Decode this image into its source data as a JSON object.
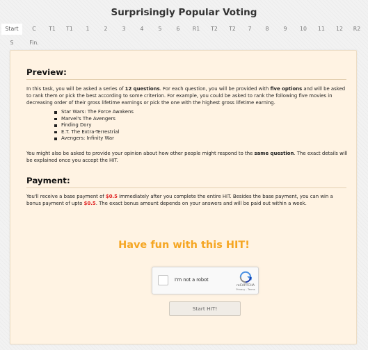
{
  "app": {
    "title": "Surprisingly Popular Voting"
  },
  "steps": {
    "row1": [
      "Start",
      "C",
      "T1",
      "T1",
      "1",
      "2",
      "3",
      "4",
      "5",
      "6",
      "R1",
      "T2",
      "T2",
      "7",
      "8",
      "9",
      "10",
      "11",
      "12",
      "R2"
    ],
    "row2": [
      "S",
      "Fin."
    ],
    "active": "Start"
  },
  "preview": {
    "heading": "Preview:",
    "intro_a": "In this task, you will be asked a series of ",
    "intro_b": "12 questions",
    "intro_c": ". For each question, you will be provided with ",
    "intro_d": "five options",
    "intro_e": " and will be asked to rank them or pick the best according to some criterion. For example, you could be asked to rank the following five movies in decreasing order of their gross lifetime earnings or pick the one with the highest gross lifetime earning.",
    "movies": [
      "Star Wars: The Force Awakens",
      "Marvel's The Avengers",
      "Finding Dory",
      "E.T. The Extra-Terrestrial",
      "Avengers: Infinity War"
    ],
    "followup_a": "You might also be asked to provide your opinion about how other people might respond to the ",
    "followup_b": "same question",
    "followup_c": ". The exact details will be explained once you accept the HIT."
  },
  "payment": {
    "heading": "Payment:",
    "p_a": "You'll receive a base payment of ",
    "base_amount": "$0.5",
    "p_b": " immediately after you complete the entire HIT. Besides the base payment, you can win a bonus payment of upto ",
    "bonus_amount": "$0.5",
    "p_c": ". The exact bonus amount depends on your answers and will be paid out within a week."
  },
  "fun_text": "Have fun with this HIT!",
  "captcha": {
    "label": "I'm not a robot",
    "brand": "reCAPTCHA",
    "terms": "Privacy - Terms"
  },
  "start_button": "Start HIT!",
  "colors": {
    "accent": "#f5a623",
    "money": "#e02020",
    "panel_bg": "#fff3e3"
  }
}
